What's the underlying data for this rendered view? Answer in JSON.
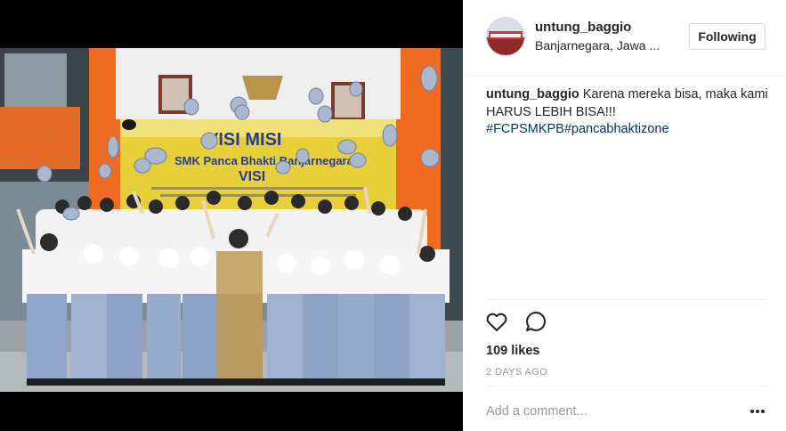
{
  "post": {
    "photo_description": "photo-students-throwing-caps",
    "banner_title": "VISI MISI",
    "banner_subtitle": "SMK Panca Bhakti Banjarnegara",
    "banner_vis": "VISI"
  },
  "header": {
    "username": "untung_baggio",
    "location": "Banjarnegara, Jawa ...",
    "follow_label": "Following"
  },
  "caption": {
    "username": "untung_baggio",
    "text": " Karena mereka bisa, maka kami HARUS LEBIH BISA!!! ",
    "hashtags": "#FCPSMKPB#pancabhaktizone"
  },
  "actions": {
    "like_icon": "heart-icon",
    "comment_icon": "comment-icon"
  },
  "likes": "109 likes",
  "time": "2 DAYS AGO",
  "comment": {
    "placeholder": "Add a comment..."
  },
  "more_icon": "more-options-icon",
  "colors": {
    "link": "#003569",
    "text": "#262626",
    "muted": "#999999",
    "divider": "#efefef",
    "uniform_top": "#f4f4f4",
    "uniform_bottom": "#8fa3c4"
  }
}
